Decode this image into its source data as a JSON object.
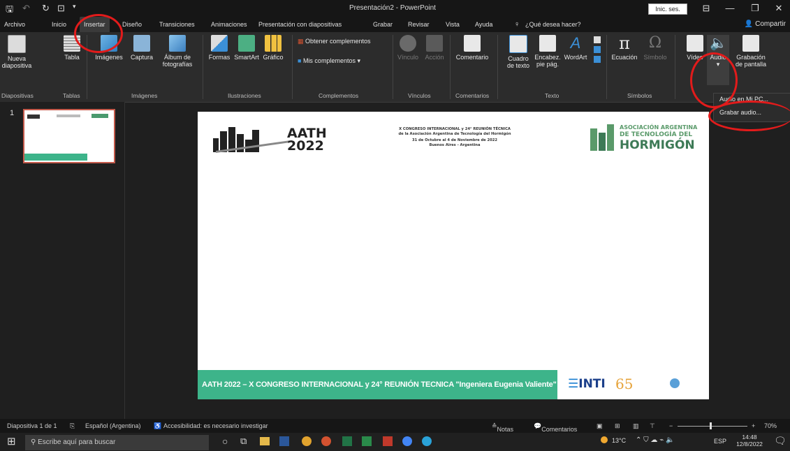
{
  "titlebar": {
    "title": "Presentación2 - PowerPoint",
    "signin": "Inic. ses."
  },
  "tabs": [
    "Archivo",
    "Inicio",
    "Insertar",
    "Diseño",
    "Transiciones",
    "Animaciones",
    "Presentación con diapositivas",
    "Grabar",
    "Revisar",
    "Vista",
    "Ayuda"
  ],
  "tell_me": "¿Qué desea hacer?",
  "share": "Compartir",
  "ribbon": {
    "nueva": "Nueva",
    "diapositiva": "diapositiva",
    "tabla": "Tabla",
    "imagenes": "Imágenes",
    "captura": "Captura",
    "album1": "Álbum de",
    "album2": "fotografías",
    "formas": "Formas",
    "smartart": "SmartArt",
    "grafico": "Gráfico",
    "obtener": "Obtener complementos",
    "mis": "Mis complementos",
    "vinculo": "Vínculo",
    "accion": "Acción",
    "comentario": "Comentario",
    "cuadro1": "Cuadro",
    "cuadro2": "de texto",
    "encab1": "Encabez.",
    "encab2": "pie pág.",
    "wordart": "WordArt",
    "ecuacion": "Ecuación",
    "simbolo": "Símbolo",
    "video": "Vídeo",
    "audio": "Audio",
    "grab1": "Grabación",
    "grab2": "de pantalla",
    "groups": {
      "diapositivas": "Diapositivas",
      "tablas": "Tablas",
      "imagenes": "Imágenes",
      "ilustraciones": "Ilustraciones",
      "complementos": "Complementos",
      "vinculos": "Vínculos",
      "comentarios": "Comentarios",
      "texto": "Texto",
      "simbolos": "Símbolos"
    }
  },
  "audio_menu": {
    "item1": "Audio en Mi PC...",
    "item2": "Grabar audio..."
  },
  "thumbnail": {
    "number": "1"
  },
  "slide": {
    "logo_line1": "AATH",
    "logo_line2": "2022",
    "header_line1": "X CONGRESO INTERNACIONAL y 24° REUNIÓN TÉCNICA",
    "header_line2": "de la Asociación Argentina de Tecnología del Hormigón",
    "header_line3": "31 de Octubre al 4 de Noviembre de 2022",
    "header_line4": "Buenos Aires - Argentina",
    "assoc_line1": "ASOCIACIÓN ARGENTINA",
    "assoc_line2": "DE TECNOLOGÍA DEL",
    "assoc_line3": "HORMIGÓN",
    "footer_text": "AATH 2022 – X CONGRESO INTERNACIONAL y 24° REUNIÓN TECNICA \"Ingeniera Eugenia Valiente\"",
    "inti": "INTI",
    "sixty_five": "65"
  },
  "statusbar": {
    "slide": "Diapositiva 1 de 1",
    "lang": "Español (Argentina)",
    "access": "Accesibilidad: es necesario investigar",
    "notas": "Notas",
    "comentarios": "Comentarios",
    "zoom": "70%"
  },
  "taskbar": {
    "search": "Escribe aquí para buscar",
    "temp": "13°C",
    "lang": "ESP",
    "time": "14:48",
    "date": "12/8/2022"
  },
  "colors": {
    "accent_green": "#3db48a",
    "annotation_red": "#e21b1b",
    "powerpoint_orange": "#d35230"
  }
}
